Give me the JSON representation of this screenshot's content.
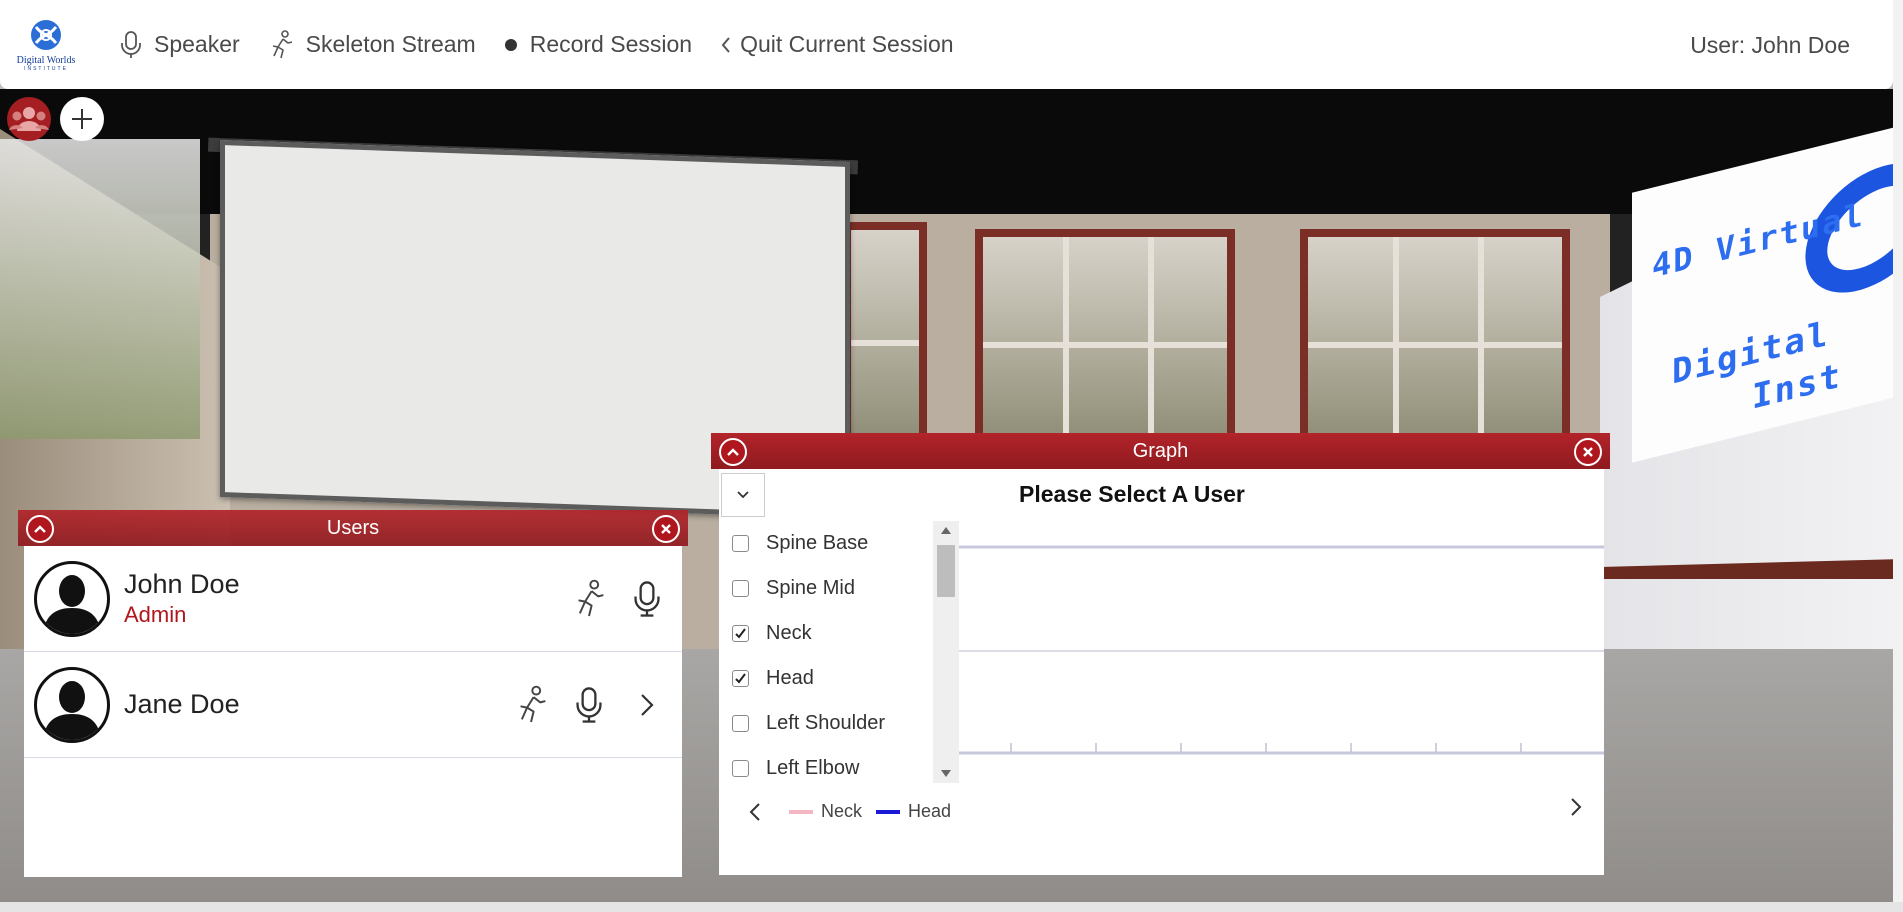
{
  "brand": {
    "name": "Digital Worlds",
    "sub": "INSTITUTE"
  },
  "nav": {
    "speaker": "Speaker",
    "skeleton": "Skeleton Stream",
    "record": "Record Session",
    "quit": "Quit Current Session",
    "user": "User: John Doe"
  },
  "scene": {
    "banner_line1": "4D Virtual",
    "banner_line2": "Digital",
    "banner_line3": "Inst"
  },
  "users_panel": {
    "title": "Users",
    "users": [
      {
        "name": "John Doe",
        "role": "Admin"
      },
      {
        "name": "Jane Doe",
        "role": ""
      }
    ]
  },
  "graph_panel": {
    "title": "Graph",
    "heading": "Please Select A User",
    "joints": [
      {
        "label": "Spine Base",
        "checked": false
      },
      {
        "label": "Spine Mid",
        "checked": false
      },
      {
        "label": "Neck",
        "checked": true
      },
      {
        "label": "Head",
        "checked": true
      },
      {
        "label": "Left Shoulder",
        "checked": false
      },
      {
        "label": "Left Elbow",
        "checked": false
      }
    ],
    "legend": [
      {
        "name": "Neck",
        "color": "#f4b6c2"
      },
      {
        "name": "Head",
        "color": "#1a1ad6"
      }
    ]
  },
  "colors": {
    "accent": "#a41e22",
    "role": "#b0161d"
  }
}
